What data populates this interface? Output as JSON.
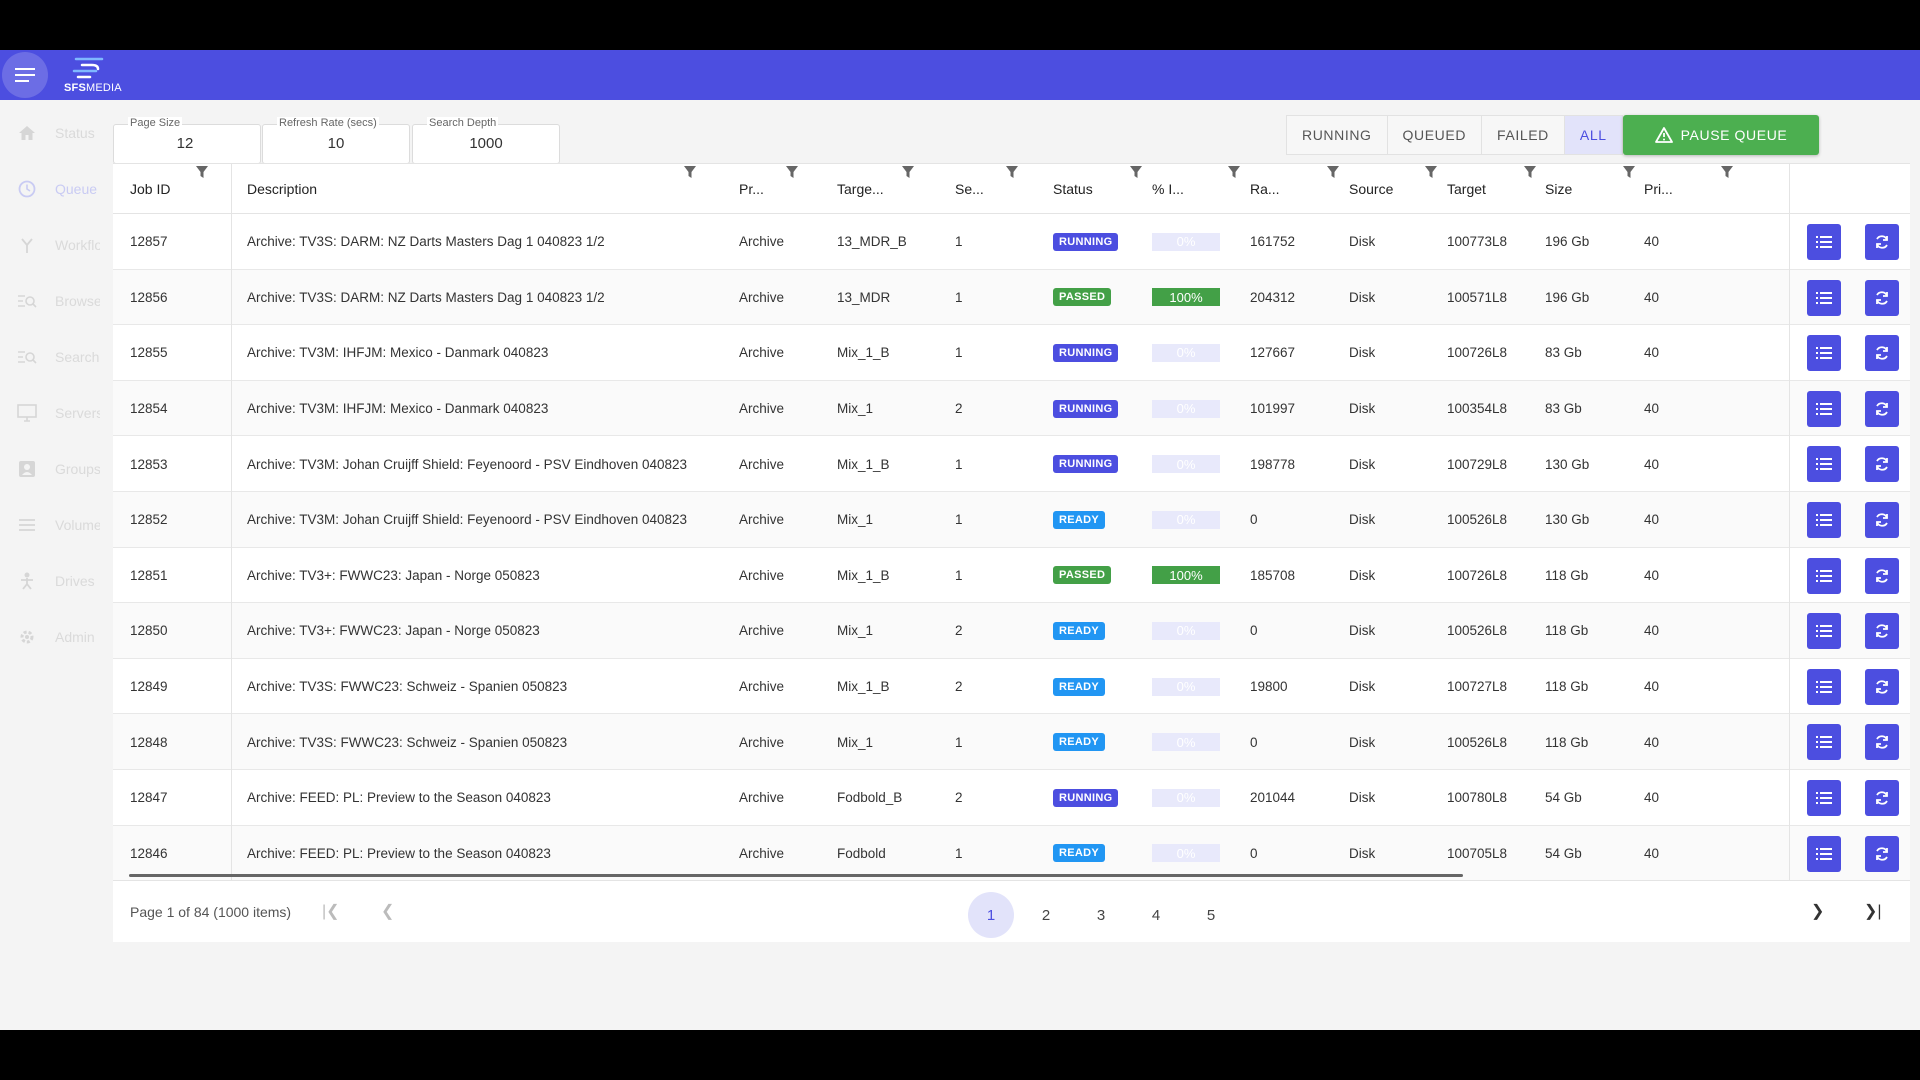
{
  "app": {
    "logo_text_bold": "SFS",
    "logo_text_light": "MEDIA"
  },
  "sidebar": {
    "items": [
      {
        "label": "Status",
        "icon": "home-icon"
      },
      {
        "label": "Queue",
        "icon": "clock-icon"
      },
      {
        "label": "Workflows",
        "icon": "workflow-icon"
      },
      {
        "label": "Browse",
        "icon": "browse-icon"
      },
      {
        "label": "Search",
        "icon": "search-icon"
      },
      {
        "label": "Servers",
        "icon": "monitor-icon"
      },
      {
        "label": "Groups",
        "icon": "groups-icon"
      },
      {
        "label": "Volumes",
        "icon": "list-icon"
      },
      {
        "label": "Drives",
        "icon": "person-icon"
      },
      {
        "label": "Admin",
        "icon": "gear-icon"
      }
    ],
    "active": "Queue"
  },
  "controls": {
    "page_size_label": "Page Size",
    "page_size_value": "12",
    "refresh_label": "Refresh Rate (secs)",
    "refresh_value": "10",
    "depth_label": "Search Depth",
    "depth_value": "1000",
    "filters": [
      "RUNNING",
      "QUEUED",
      "FAILED",
      "ALL"
    ],
    "selected_filter": "ALL",
    "pause_label": "PAUSE QUEUE"
  },
  "table": {
    "headers": [
      "Job ID",
      "Description",
      "Pr...",
      "Targe...",
      "Se...",
      "Status",
      "% I...",
      "Ra...",
      "Source",
      "Target",
      "Size",
      "Pri..."
    ],
    "rows": [
      {
        "id": "12857",
        "desc": "Archive: TV3S: DARM: NZ Darts Masters Dag 1 040823 1/2",
        "process": "Archive",
        "target_group": "13_MDR_B",
        "seq": "1",
        "status": "RUNNING",
        "pct": "0%",
        "rate": "161752",
        "source": "Disk",
        "target": "100773L8",
        "size": "196 Gb",
        "pri": "40"
      },
      {
        "id": "12856",
        "desc": "Archive: TV3S: DARM: NZ Darts Masters Dag 1 040823 1/2",
        "process": "Archive",
        "target_group": "13_MDR",
        "seq": "1",
        "status": "PASSED",
        "pct": "100%",
        "rate": "204312",
        "source": "Disk",
        "target": "100571L8",
        "size": "196 Gb",
        "pri": "40"
      },
      {
        "id": "12855",
        "desc": "Archive: TV3M: IHFJM: Mexico - Danmark 040823",
        "process": "Archive",
        "target_group": "Mix_1_B",
        "seq": "1",
        "status": "RUNNING",
        "pct": "0%",
        "rate": "127667",
        "source": "Disk",
        "target": "100726L8",
        "size": "83 Gb",
        "pri": "40"
      },
      {
        "id": "12854",
        "desc": "Archive: TV3M: IHFJM: Mexico - Danmark 040823",
        "process": "Archive",
        "target_group": "Mix_1",
        "seq": "2",
        "status": "RUNNING",
        "pct": "0%",
        "rate": "101997",
        "source": "Disk",
        "target": "100354L8",
        "size": "83 Gb",
        "pri": "40"
      },
      {
        "id": "12853",
        "desc": "Archive: TV3M: Johan Cruijff Shield: Feyenoord - PSV Eindhoven 040823",
        "process": "Archive",
        "target_group": "Mix_1_B",
        "seq": "1",
        "status": "RUNNING",
        "pct": "0%",
        "rate": "198778",
        "source": "Disk",
        "target": "100729L8",
        "size": "130 Gb",
        "pri": "40"
      },
      {
        "id": "12852",
        "desc": "Archive: TV3M: Johan Cruijff Shield: Feyenoord - PSV Eindhoven 040823",
        "process": "Archive",
        "target_group": "Mix_1",
        "seq": "1",
        "status": "READY",
        "pct": "0%",
        "rate": "0",
        "source": "Disk",
        "target": "100526L8",
        "size": "130 Gb",
        "pri": "40"
      },
      {
        "id": "12851",
        "desc": "Archive: TV3+: FWWC23: Japan - Norge 050823",
        "process": "Archive",
        "target_group": "Mix_1_B",
        "seq": "1",
        "status": "PASSED",
        "pct": "100%",
        "rate": "185708",
        "source": "Disk",
        "target": "100726L8",
        "size": "118 Gb",
        "pri": "40"
      },
      {
        "id": "12850",
        "desc": "Archive: TV3+: FWWC23: Japan - Norge 050823",
        "process": "Archive",
        "target_group": "Mix_1",
        "seq": "2",
        "status": "READY",
        "pct": "0%",
        "rate": "0",
        "source": "Disk",
        "target": "100526L8",
        "size": "118 Gb",
        "pri": "40"
      },
      {
        "id": "12849",
        "desc": "Archive: TV3S: FWWC23: Schweiz - Spanien 050823",
        "process": "Archive",
        "target_group": "Mix_1_B",
        "seq": "2",
        "status": "READY",
        "pct": "0%",
        "rate": "19800",
        "source": "Disk",
        "target": "100727L8",
        "size": "118 Gb",
        "pri": "40"
      },
      {
        "id": "12848",
        "desc": "Archive: TV3S: FWWC23: Schweiz - Spanien 050823",
        "process": "Archive",
        "target_group": "Mix_1",
        "seq": "1",
        "status": "READY",
        "pct": "0%",
        "rate": "0",
        "source": "Disk",
        "target": "100526L8",
        "size": "118 Gb",
        "pri": "40"
      },
      {
        "id": "12847",
        "desc": "Archive: FEED: PL: Preview to the Season 040823",
        "process": "Archive",
        "target_group": "Fodbold_B",
        "seq": "2",
        "status": "RUNNING",
        "pct": "0%",
        "rate": "201044",
        "source": "Disk",
        "target": "100780L8",
        "size": "54 Gb",
        "pri": "40"
      },
      {
        "id": "12846",
        "desc": "Archive: FEED: PL: Preview to the Season 040823",
        "process": "Archive",
        "target_group": "Fodbold",
        "seq": "1",
        "status": "READY",
        "pct": "0%",
        "rate": "0",
        "source": "Disk",
        "target": "100705L8",
        "size": "54 Gb",
        "pri": "40"
      }
    ]
  },
  "pager": {
    "info": "Page 1 of 84 (1000 items)",
    "pages": [
      "1",
      "2",
      "3",
      "4",
      "5"
    ],
    "current": "1"
  },
  "colors": {
    "brand": "#4c4ee0",
    "passed": "#43a047",
    "ready": "#2196f3",
    "pause": "#4caf50"
  }
}
